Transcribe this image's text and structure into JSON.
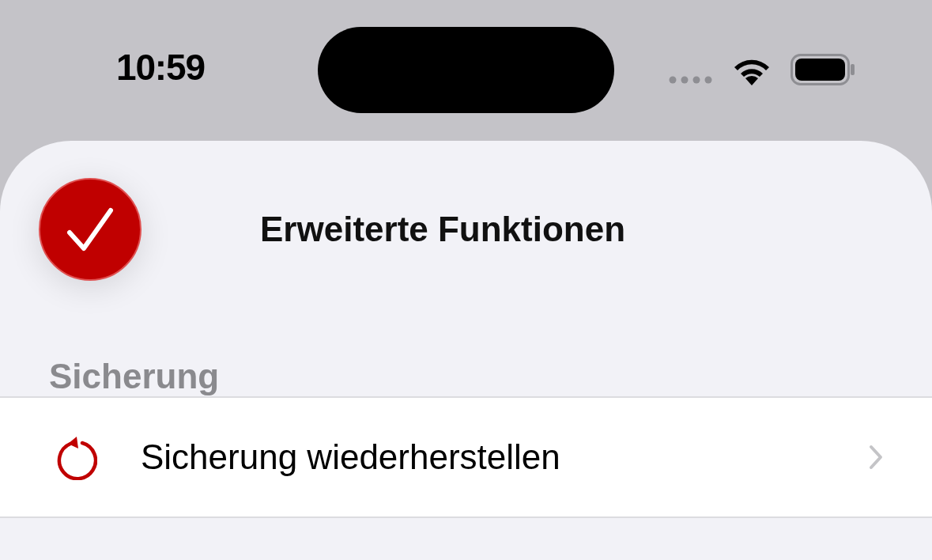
{
  "status_bar": {
    "time": "10:59"
  },
  "header": {
    "title": "Erweiterte Funktionen"
  },
  "sections": [
    {
      "title": "Sicherung",
      "rows": [
        {
          "label": "Sicherung wiederherstellen",
          "kind": "restore"
        }
      ]
    }
  ]
}
